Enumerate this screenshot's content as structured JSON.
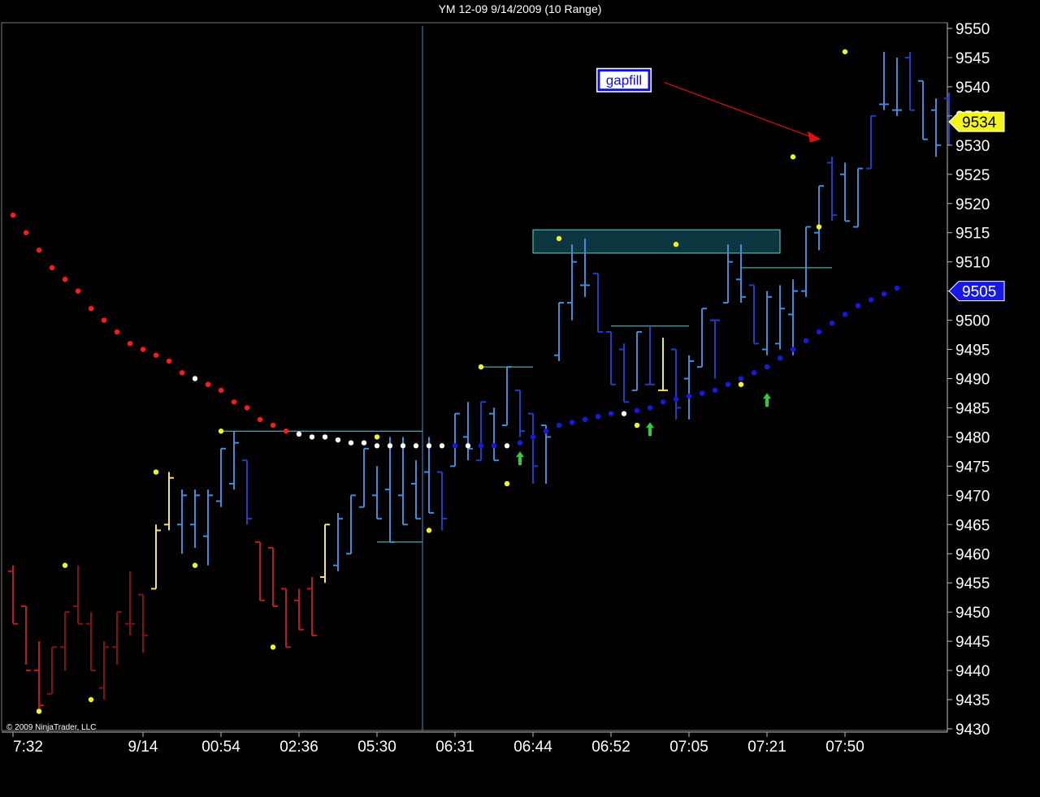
{
  "title": "YM 12-09  9/14/2009 (10 Range)",
  "copyright": "© 2009 NinjaTrader, LLC",
  "colors": {
    "background": "#000000",
    "up_bar": "#3f8ddc",
    "down_bar": "#1f3ec8",
    "down_bar_red": "#c01a1a",
    "down_bar_darkred": "#8a1010",
    "neutral_bar": "#f2e36a",
    "dot_red": "#ff1a1a",
    "dot_white": "#ffffff",
    "dot_blue": "#1818e6",
    "swing_dot": "#f5f51e",
    "level_line": "#5fd3d3",
    "arrow": "#2ecc40",
    "annotation_arrow": "#e01010",
    "gap_box_fill": "#0d3740",
    "gap_box_stroke": "#5fd3d3"
  },
  "chart_data": {
    "type": "ohlc",
    "title": "YM 12-09  9/14/2009 (10 Range)",
    "ylim": [
      9430,
      9550
    ],
    "y_ticks": [
      9430,
      9435,
      9440,
      9445,
      9450,
      9455,
      9460,
      9465,
      9470,
      9475,
      9480,
      9485,
      9490,
      9495,
      9500,
      9505,
      9510,
      9515,
      9520,
      9525,
      9530,
      9535,
      9540,
      9545,
      9550
    ],
    "x_tick_labels": [
      {
        "bar": 0,
        "label": "7:32"
      },
      {
        "bar": 10,
        "label": "9/14"
      },
      {
        "bar": 16,
        "label": "00:54"
      },
      {
        "bar": 22,
        "label": "02:36"
      },
      {
        "bar": 28,
        "label": "05:30"
      },
      {
        "bar": 34,
        "label": "06:31"
      },
      {
        "bar": 40,
        "label": "06:44"
      },
      {
        "bar": 46,
        "label": "06:52"
      },
      {
        "bar": 52,
        "label": "07:05"
      },
      {
        "bar": 58,
        "label": "07:21"
      },
      {
        "bar": 64,
        "label": "07:50"
      }
    ],
    "session_break_bar": 31.5,
    "bars": [
      {
        "o": 9457,
        "h": 9458,
        "l": 9448,
        "c": 9448,
        "color": "down_bar_red"
      },
      {
        "o": 9451,
        "h": 9451,
        "l": 9441,
        "c": 9440,
        "color": "down_bar_red"
      },
      {
        "o": 9440,
        "h": 9445,
        "l": 9433,
        "c": 9434,
        "color": "down_bar_red"
      },
      {
        "o": 9436,
        "h": 9444,
        "l": 9436,
        "c": 9444,
        "color": "down_bar_darkred"
      },
      {
        "o": 9444,
        "h": 9450,
        "l": 9440,
        "c": 9450,
        "color": "down_bar_darkred"
      },
      {
        "o": 9451,
        "h": 9458,
        "l": 9448,
        "c": 9448,
        "color": "down_bar_darkred"
      },
      {
        "o": 9448,
        "h": 9450,
        "l": 9440,
        "c": 9440,
        "color": "down_bar_darkred"
      },
      {
        "o": 9437,
        "h": 9445,
        "l": 9435,
        "c": 9444,
        "color": "down_bar_darkred"
      },
      {
        "o": 9444,
        "h": 9450,
        "l": 9441,
        "c": 9450,
        "color": "down_bar_darkred"
      },
      {
        "o": 9448,
        "h": 9457,
        "l": 9446,
        "c": 9448,
        "color": "down_bar_darkred"
      },
      {
        "o": 9453,
        "h": 9453,
        "l": 9443,
        "c": 9446,
        "color": "down_bar_darkred"
      },
      {
        "o": 9454,
        "h": 9465,
        "l": 9454,
        "c": 9464,
        "color": "neutral_bar"
      },
      {
        "o": 9465,
        "h": 9474,
        "l": 9464,
        "c": 9473,
        "color": "neutral_bar"
      },
      {
        "o": 9465,
        "h": 9471,
        "l": 9460,
        "c": 9470,
        "color": "up_bar"
      },
      {
        "o": 9465,
        "h": 9471,
        "l": 9461,
        "c": 9470,
        "color": "up_bar"
      },
      {
        "o": 9463,
        "h": 9471,
        "l": 9458,
        "c": 9470,
        "color": "up_bar"
      },
      {
        "o": 9469,
        "h": 9478,
        "l": 9468,
        "c": 9478,
        "color": "up_bar"
      },
      {
        "o": 9472,
        "h": 9481,
        "l": 9471,
        "c": 9479,
        "color": "up_bar"
      },
      {
        "o": 9476,
        "h": 9476,
        "l": 9465,
        "c": 9466,
        "color": "down_bar"
      },
      {
        "o": 9462,
        "h": 9462,
        "l": 9452,
        "c": 9452,
        "color": "down_bar_red"
      },
      {
        "o": 9461,
        "h": 9461,
        "l": 9451,
        "c": 9451,
        "color": "down_bar_red"
      },
      {
        "o": 9454,
        "h": 9454,
        "l": 9444,
        "c": 9444,
        "color": "down_bar_red"
      },
      {
        "o": 9452,
        "h": 9454,
        "l": 9447,
        "c": 9447,
        "color": "down_bar_red"
      },
      {
        "o": 9454,
        "h": 9456,
        "l": 9446,
        "c": 9446,
        "color": "down_bar_red"
      },
      {
        "o": 9456,
        "h": 9465,
        "l": 9455,
        "c": 9465,
        "color": "neutral_bar"
      },
      {
        "o": 9458,
        "h": 9467,
        "l": 9457,
        "c": 9466,
        "color": "up_bar"
      },
      {
        "o": 9460,
        "h": 9470,
        "l": 9460,
        "c": 9470,
        "color": "up_bar"
      },
      {
        "o": 9468,
        "h": 9478,
        "l": 9468,
        "c": 9478,
        "color": "up_bar"
      },
      {
        "o": 9470,
        "h": 9475,
        "l": 9466,
        "c": 9466,
        "color": "up_bar"
      },
      {
        "o": 9471,
        "h": 9480,
        "l": 9462,
        "c": 9462,
        "color": "up_bar"
      },
      {
        "o": 9470,
        "h": 9480,
        "l": 9465,
        "c": 9465,
        "color": "up_bar"
      },
      {
        "o": 9472,
        "h": 9476,
        "l": 9466,
        "c": 9466,
        "color": "up_bar"
      },
      {
        "o": 9474,
        "h": 9480,
        "l": 9467,
        "c": 9467,
        "color": "up_bar"
      },
      {
        "o": 9474,
        "h": 9474,
        "l": 9464,
        "c": 9466,
        "color": "down_bar"
      },
      {
        "o": 9475,
        "h": 9484,
        "l": 9475,
        "c": 9484,
        "color": "up_bar"
      },
      {
        "o": 9480,
        "h": 9486,
        "l": 9476,
        "c": 9478,
        "color": "up_bar"
      },
      {
        "o": 9476,
        "h": 9486,
        "l": 9476,
        "c": 9486,
        "color": "down_bar"
      },
      {
        "o": 9484,
        "h": 9485,
        "l": 9476,
        "c": 9476,
        "color": "up_bar"
      },
      {
        "o": 9482,
        "h": 9492,
        "l": 9482,
        "c": 9492,
        "color": "up_bar"
      },
      {
        "o": 9488,
        "h": 9488,
        "l": 9480,
        "c": 9481,
        "color": "down_bar"
      },
      {
        "o": 9484,
        "h": 9484,
        "l": 9472,
        "c": 9475,
        "color": "down_bar"
      },
      {
        "o": 9482,
        "h": 9482,
        "l": 9472,
        "c": 9480,
        "color": "up_bar"
      },
      {
        "o": 9494,
        "h": 9503,
        "l": 9493,
        "c": 9503,
        "color": "up_bar"
      },
      {
        "o": 9503,
        "h": 9513,
        "l": 9500,
        "c": 9510,
        "color": "up_bar"
      },
      {
        "o": 9506,
        "h": 9514,
        "l": 9504,
        "c": 9506,
        "color": "up_bar"
      },
      {
        "o": 9508,
        "h": 9508,
        "l": 9498,
        "c": 9498,
        "color": "down_bar"
      },
      {
        "o": 9498,
        "h": 9498,
        "l": 9489,
        "c": 9489,
        "color": "down_bar"
      },
      {
        "o": 9495,
        "h": 9496,
        "l": 9486,
        "c": 9486,
        "color": "down_bar"
      },
      {
        "o": 9488,
        "h": 9498,
        "l": 9488,
        "c": 9498,
        "color": "up_bar"
      },
      {
        "o": 9489,
        "h": 9499,
        "l": 9489,
        "c": 9489,
        "color": "down_bar"
      },
      {
        "o": 9488,
        "h": 9497,
        "l": 9488,
        "c": 9488,
        "color": "neutral_bar"
      },
      {
        "o": 9495,
        "h": 9495,
        "l": 9483,
        "c": 9485,
        "color": "down_bar"
      },
      {
        "o": 9490,
        "h": 9494,
        "l": 9483,
        "c": 9493,
        "color": "up_bar"
      },
      {
        "o": 9492,
        "h": 9502,
        "l": 9492,
        "c": 9502,
        "color": "up_bar"
      },
      {
        "o": 9500,
        "h": 9500,
        "l": 9490,
        "c": 9500,
        "color": "down_bar"
      },
      {
        "o": 9503,
        "h": 9513,
        "l": 9503,
        "c": 9510,
        "color": "up_bar"
      },
      {
        "o": 9507,
        "h": 9513,
        "l": 9503,
        "c": 9504,
        "color": "up_bar"
      },
      {
        "o": 9506,
        "h": 9506,
        "l": 9496,
        "c": 9496,
        "color": "down_bar"
      },
      {
        "o": 9495,
        "h": 9505,
        "l": 9494,
        "c": 9504,
        "color": "up_bar"
      },
      {
        "o": 9496,
        "h": 9506,
        "l": 9495,
        "c": 9502,
        "color": "up_bar"
      },
      {
        "o": 9501,
        "h": 9507,
        "l": 9494,
        "c": 9505,
        "color": "up_bar"
      }
    ],
    "dots_left": [
      {
        "x": 0,
        "y": 9518,
        "color": "dot_red"
      },
      {
        "x": 1,
        "y": 9515,
        "color": "dot_red"
      },
      {
        "x": 2,
        "y": 9512,
        "color": "dot_red"
      },
      {
        "x": 3,
        "y": 9509,
        "color": "dot_red"
      },
      {
        "x": 4,
        "y": 9507,
        "color": "dot_red"
      },
      {
        "x": 5,
        "y": 9505,
        "color": "dot_red"
      },
      {
        "x": 6,
        "y": 9502,
        "color": "dot_red"
      },
      {
        "x": 7,
        "y": 9500,
        "color": "dot_red"
      },
      {
        "x": 8,
        "y": 9498,
        "color": "dot_red"
      },
      {
        "x": 9,
        "y": 9496,
        "color": "dot_red"
      },
      {
        "x": 10,
        "y": 9495,
        "color": "dot_red"
      },
      {
        "x": 11,
        "y": 9494,
        "color": "dot_red"
      },
      {
        "x": 12,
        "y": 9493,
        "color": "dot_red"
      },
      {
        "x": 13,
        "y": 9491,
        "color": "dot_red"
      },
      {
        "x": 14,
        "y": 9490,
        "color": "dot_white"
      },
      {
        "x": 15,
        "y": 9489,
        "color": "dot_red"
      },
      {
        "x": 16,
        "y": 9488,
        "color": "dot_red"
      },
      {
        "x": 17,
        "y": 9486,
        "color": "dot_red"
      },
      {
        "x": 18,
        "y": 9485,
        "color": "dot_red"
      },
      {
        "x": 19,
        "y": 9483,
        "color": "dot_red"
      },
      {
        "x": 20,
        "y": 9482,
        "color": "dot_red"
      },
      {
        "x": 21,
        "y": 9481,
        "color": "dot_red"
      },
      {
        "x": 22,
        "y": 9480.5,
        "color": "dot_white"
      },
      {
        "x": 23,
        "y": 9480,
        "color": "dot_white"
      },
      {
        "x": 24,
        "y": 9480,
        "color": "dot_white"
      },
      {
        "x": 25,
        "y": 9479.5,
        "color": "dot_white"
      },
      {
        "x": 26,
        "y": 9479,
        "color": "dot_white"
      },
      {
        "x": 27,
        "y": 9479,
        "color": "dot_white"
      },
      {
        "x": 28,
        "y": 9478.5,
        "color": "dot_white"
      },
      {
        "x": 29,
        "y": 9478.5,
        "color": "dot_white"
      },
      {
        "x": 30,
        "y": 9478.5,
        "color": "dot_white"
      },
      {
        "x": 31,
        "y": 9478.5,
        "color": "dot_white"
      },
      {
        "x": 32,
        "y": 9478.5,
        "color": "dot_white"
      },
      {
        "x": 33,
        "y": 9478.5,
        "color": "dot_white"
      },
      {
        "x": 34,
        "y": 9478.5,
        "color": "dot_blue"
      },
      {
        "x": 35,
        "y": 9478.5,
        "color": "dot_white"
      },
      {
        "x": 36,
        "y": 9478.5,
        "color": "dot_blue"
      },
      {
        "x": 37,
        "y": 9478.5,
        "color": "dot_blue"
      },
      {
        "x": 38,
        "y": 9478.5,
        "color": "dot_white"
      },
      {
        "x": 39,
        "y": 9479,
        "color": "dot_blue"
      },
      {
        "x": 40,
        "y": 9480,
        "color": "dot_blue"
      },
      {
        "x": 41,
        "y": 9481,
        "color": "dot_blue"
      },
      {
        "x": 42,
        "y": 9482,
        "color": "dot_blue"
      },
      {
        "x": 43,
        "y": 9482.5,
        "color": "dot_blue"
      },
      {
        "x": 44,
        "y": 9483,
        "color": "dot_blue"
      },
      {
        "x": 45,
        "y": 9483.5,
        "color": "dot_blue"
      },
      {
        "x": 46,
        "y": 9484,
        "color": "dot_blue"
      },
      {
        "x": 47,
        "y": 9484,
        "color": "dot_white"
      },
      {
        "x": 48,
        "y": 9484.5,
        "color": "dot_blue"
      },
      {
        "x": 49,
        "y": 9485,
        "color": "dot_blue"
      },
      {
        "x": 50,
        "y": 9486,
        "color": "dot_blue"
      },
      {
        "x": 51,
        "y": 9486.5,
        "color": "dot_blue"
      },
      {
        "x": 52,
        "y": 9487,
        "color": "dot_blue"
      },
      {
        "x": 53,
        "y": 9487.5,
        "color": "dot_blue"
      },
      {
        "x": 54,
        "y": 9488,
        "color": "dot_blue"
      },
      {
        "x": 55,
        "y": 9489,
        "color": "dot_blue"
      },
      {
        "x": 56,
        "y": 9490,
        "color": "dot_blue"
      },
      {
        "x": 57,
        "y": 9491,
        "color": "dot_blue"
      },
      {
        "x": 58,
        "y": 9492,
        "color": "dot_blue"
      },
      {
        "x": 59,
        "y": 9493.5,
        "color": "dot_blue"
      },
      {
        "x": 60,
        "y": 9495,
        "color": "dot_blue"
      },
      {
        "x": 61,
        "y": 9496.5,
        "color": "dot_blue"
      },
      {
        "x": 62,
        "y": 9498,
        "color": "dot_blue"
      },
      {
        "x": 63,
        "y": 9499.5,
        "color": "dot_blue"
      },
      {
        "x": 64,
        "y": 9501,
        "color": "dot_blue"
      },
      {
        "x": 65,
        "y": 9502.5,
        "color": "dot_blue"
      },
      {
        "x": 66,
        "y": 9503.5,
        "color": "dot_blue"
      },
      {
        "x": 67,
        "y": 9504.5,
        "color": "dot_blue"
      },
      {
        "x": 68,
        "y": 9505.5,
        "color": "dot_blue"
      }
    ],
    "swing_points": [
      {
        "bar": 2,
        "y": 9433
      },
      {
        "bar": 4,
        "y": 9458
      },
      {
        "bar": 6,
        "y": 9435
      },
      {
        "bar": 11,
        "y": 9474
      },
      {
        "bar": 14,
        "y": 9458
      },
      {
        "bar": 16,
        "y": 9481
      },
      {
        "bar": 20,
        "y": 9444
      },
      {
        "bar": 28,
        "y": 9480
      },
      {
        "bar": 32,
        "y": 9464
      },
      {
        "bar": 36,
        "y": 9492
      },
      {
        "bar": 38,
        "y": 9472
      },
      {
        "bar": 42,
        "y": 9514
      },
      {
        "bar": 48,
        "y": 9482
      },
      {
        "bar": 51,
        "y": 9513
      },
      {
        "bar": 56,
        "y": 9489
      },
      {
        "bar": 60,
        "y": 9528
      },
      {
        "bar": 62,
        "y": 9516
      },
      {
        "bar": 64,
        "y": 9546
      }
    ],
    "trend_up_bars": [
      {
        "o": 9505,
        "h": 9516,
        "l": 9504,
        "c": 9516
      },
      {
        "o": 9515,
        "h": 9523,
        "l": 9512,
        "c": 9523
      },
      {
        "o": 9527,
        "h": 9528,
        "l": 9517,
        "c": 9518
      },
      {
        "o": 9525,
        "h": 9527,
        "l": 9517,
        "c": 9517
      },
      {
        "o": 9516,
        "h": 9526,
        "l": 9516,
        "c": 9526
      },
      {
        "o": 9526,
        "h": 9535,
        "l": 9526,
        "c": 9535
      },
      {
        "o": 9537,
        "h": 9546,
        "l": 9536,
        "c": 9537
      },
      {
        "o": 9536,
        "h": 9545,
        "l": 9535,
        "c": 9536
      },
      {
        "o": 9545,
        "h": 9546,
        "l": 9536,
        "c": 9536
      },
      {
        "o": 9541,
        "h": 9541,
        "l": 9531,
        "c": 9531
      },
      {
        "o": 9536,
        "h": 9538,
        "l": 9528,
        "c": 9530
      },
      {
        "o": 9538,
        "h": 9539,
        "l": 9530,
        "c": 9534
      }
    ],
    "levels": [
      {
        "from_bar": 16,
        "to_bar": 31.5,
        "y": 9481
      },
      {
        "from_bar": 28,
        "to_bar": 31.5,
        "y": 9462
      },
      {
        "from_bar": 36,
        "to_bar": 40,
        "y": 9492
      },
      {
        "from_bar": 46,
        "to_bar": 52,
        "y": 9499
      },
      {
        "from_bar": 56,
        "to_bar": 63,
        "y": 9509
      }
    ],
    "gap_box": {
      "from_bar": 40,
      "to_bar": 59,
      "y_low": 9511.5,
      "y_high": 9515.5
    },
    "up_arrows": [
      {
        "bar": 39,
        "y": 9476
      },
      {
        "bar": 49,
        "y": 9481
      },
      {
        "bar": 58,
        "y": 9486
      }
    ],
    "price_markers": [
      {
        "value": "9534",
        "y": 9534,
        "bg": "#f5f51e",
        "fg": "#000000"
      },
      {
        "value": "9505",
        "y": 9505,
        "bg": "#1818e6",
        "fg": "#ffffff"
      }
    ],
    "annotation": {
      "text": "gapfill",
      "from_price": 9541,
      "to_price": 9531
    }
  }
}
